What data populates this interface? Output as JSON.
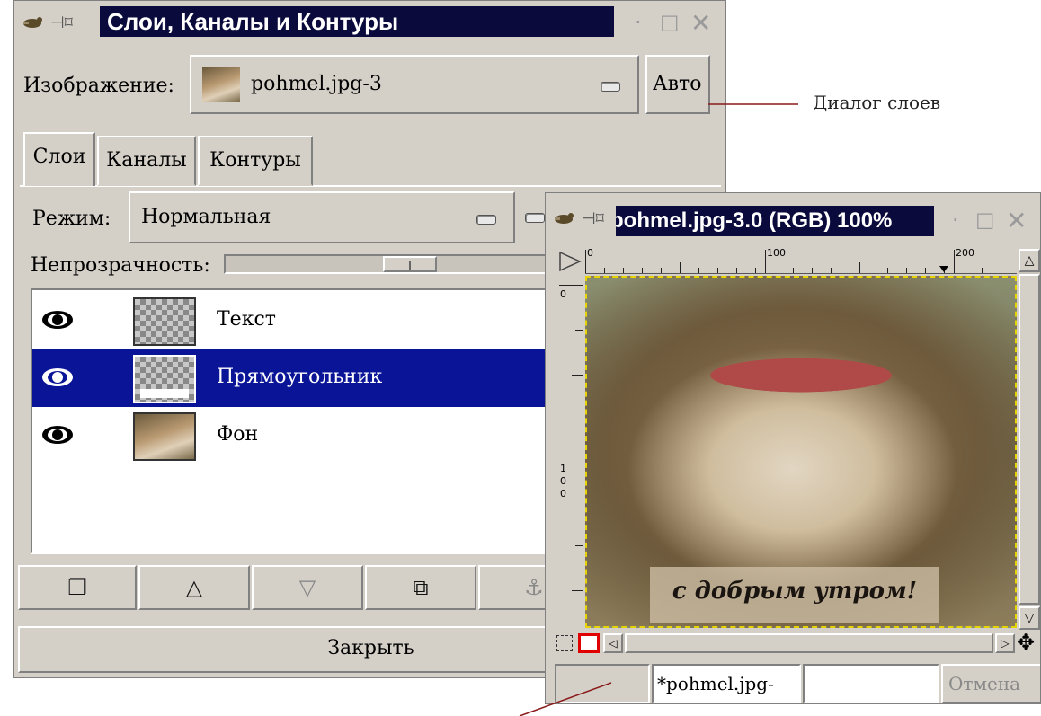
{
  "layers_dialog": {
    "title": "Слои, Каналы и Контуры",
    "image_label": "Изображение:",
    "image_value": "pohmel.jpg-3",
    "auto_button": "Авто",
    "tabs": [
      "Слои",
      "Каналы",
      "Контуры"
    ],
    "mode_label": "Режим:",
    "mode_value": "Нормальная",
    "opacity_label": "Непрозрачность:",
    "layers": [
      {
        "name": "Текст",
        "visible": true,
        "selected": false
      },
      {
        "name": "Прямоугольник",
        "visible": true,
        "selected": true
      },
      {
        "name": "Фон",
        "visible": true,
        "selected": false
      }
    ],
    "buttons": [
      "new-layer-icon",
      "raise-layer-icon",
      "lower-layer-icon",
      "duplicate-layer-icon",
      "anchor-layer-icon"
    ],
    "close_button": "Закрыть"
  },
  "image_window": {
    "title": "pohmel.jpg-3.0 (RGB) 100%",
    "ruler_h_labels": [
      "0",
      "100",
      "200"
    ],
    "ruler_v_labels": [
      "0",
      "1",
      "0",
      "0"
    ],
    "photo_caption": "с добрым утром!",
    "status_filename": "*pohmel.jpg-",
    "cancel_button": "Отмена"
  },
  "annotations": {
    "layers_dialog_label": "Диалог слоев"
  },
  "colors": {
    "title_bg": "#0a0a3c",
    "selection_bg": "#0a1496",
    "window_bg": "#d4d0c8"
  }
}
